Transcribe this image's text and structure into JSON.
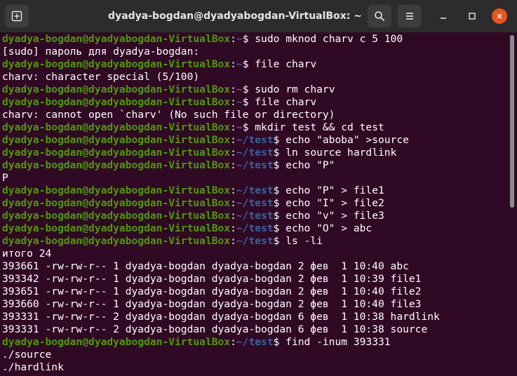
{
  "window": {
    "title": "dyadya-bogdan@dyadyabogdan-VirtualBox: ~"
  },
  "icons": {
    "new_tab": "new-tab-icon",
    "search": "search-icon",
    "menu": "hamburger-menu-icon",
    "minimize": "minimize-icon",
    "maximize": "maximize-icon",
    "close": "close-icon"
  },
  "colors": {
    "background": "#300a24",
    "prompt_user": "#4e9a06",
    "prompt_path": "#3465a4",
    "text": "#ffffff",
    "titlebar": "#2c2c2c",
    "close_button": "#e95420"
  },
  "terminal": {
    "lines": [
      {
        "type": "prompt",
        "user": "dyadya-bogdan@dyadyabogdan-VirtualBox",
        "sep": ":",
        "path": "~",
        "cmd": "$ sudo mknod charv c 5 100"
      },
      {
        "type": "output",
        "text": "[sudo] пароль для dyadya-bogdan:"
      },
      {
        "type": "prompt",
        "user": "dyadya-bogdan@dyadyabogdan-VirtualBox",
        "sep": ":",
        "path": "~",
        "cmd": "$ file charv"
      },
      {
        "type": "output",
        "text": "charv: character special (5/100)"
      },
      {
        "type": "prompt",
        "user": "dyadya-bogdan@dyadyabogdan-VirtualBox",
        "sep": ":",
        "path": "~",
        "cmd": "$ sudo rm charv"
      },
      {
        "type": "prompt",
        "user": "dyadya-bogdan@dyadyabogdan-VirtualBox",
        "sep": ":",
        "path": "~",
        "cmd": "$ file charv"
      },
      {
        "type": "output",
        "text": "charv: cannot open `charv' (No such file or directory)"
      },
      {
        "type": "prompt",
        "user": "dyadya-bogdan@dyadyabogdan-VirtualBox",
        "sep": ":",
        "path": "~",
        "cmd": "$ mkdir test && cd test"
      },
      {
        "type": "prompt",
        "user": "dyadya-bogdan@dyadyabogdan-VirtualBox",
        "sep": ":",
        "path": "~/test",
        "cmd": "$ echo \"aboba\" >source"
      },
      {
        "type": "prompt",
        "user": "dyadya-bogdan@dyadyabogdan-VirtualBox",
        "sep": ":",
        "path": "~/test",
        "cmd": "$ ln source hardlink"
      },
      {
        "type": "prompt",
        "user": "dyadya-bogdan@dyadyabogdan-VirtualBox",
        "sep": ":",
        "path": "~/test",
        "cmd": "$ echo \"P\""
      },
      {
        "type": "output",
        "text": "P"
      },
      {
        "type": "prompt",
        "user": "dyadya-bogdan@dyadyabogdan-VirtualBox",
        "sep": ":",
        "path": "~/test",
        "cmd": "$ echo \"P\" > file1"
      },
      {
        "type": "prompt",
        "user": "dyadya-bogdan@dyadyabogdan-VirtualBox",
        "sep": ":",
        "path": "~/test",
        "cmd": "$ echo \"I\" > file2"
      },
      {
        "type": "prompt",
        "user": "dyadya-bogdan@dyadyabogdan-VirtualBox",
        "sep": ":",
        "path": "~/test",
        "cmd": "$ echo \"v\" > file3"
      },
      {
        "type": "prompt",
        "user": "dyadya-bogdan@dyadyabogdan-VirtualBox",
        "sep": ":",
        "path": "~/test",
        "cmd": "$ echo \"O\" > abc"
      },
      {
        "type": "prompt",
        "user": "dyadya-bogdan@dyadyabogdan-VirtualBox",
        "sep": ":",
        "path": "~/test",
        "cmd": "$ ls -li"
      },
      {
        "type": "output",
        "text": "итого 24"
      },
      {
        "type": "output",
        "text": "393661 -rw-rw-r-- 1 dyadya-bogdan dyadya-bogdan 2 фев  1 10:40 abc"
      },
      {
        "type": "output",
        "text": "393342 -rw-rw-r-- 1 dyadya-bogdan dyadya-bogdan 2 фев  1 10:39 file1"
      },
      {
        "type": "output",
        "text": "393651 -rw-rw-r-- 1 dyadya-bogdan dyadya-bogdan 2 фев  1 10:40 file2"
      },
      {
        "type": "output",
        "text": "393660 -rw-rw-r-- 1 dyadya-bogdan dyadya-bogdan 2 фев  1 10:40 file3"
      },
      {
        "type": "output",
        "text": "393331 -rw-rw-r-- 2 dyadya-bogdan dyadya-bogdan 6 фев  1 10:38 hardlink"
      },
      {
        "type": "output",
        "text": "393331 -rw-rw-r-- 2 dyadya-bogdan dyadya-bogdan 6 фев  1 10:38 source"
      },
      {
        "type": "prompt",
        "user": "dyadya-bogdan@dyadyabogdan-VirtualBox",
        "sep": ":",
        "path": "~/test",
        "cmd": "$ find -inum 393331"
      },
      {
        "type": "output",
        "text": "./source"
      },
      {
        "type": "output",
        "text": "./hardlink"
      }
    ]
  }
}
